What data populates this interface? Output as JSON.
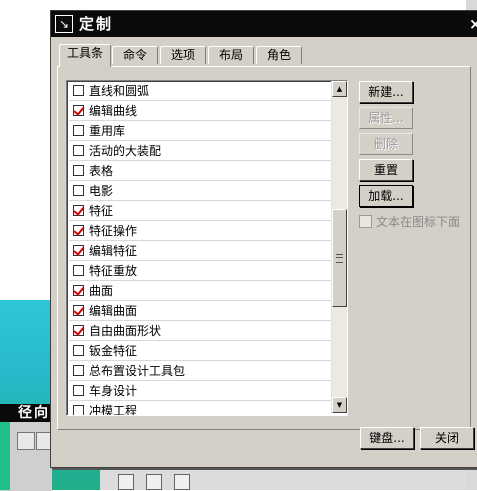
{
  "dialog": {
    "title": "定制",
    "close_glyph": "×",
    "icon_glyph": "↘"
  },
  "tabs": [
    {
      "label": "工具条",
      "active": true
    },
    {
      "label": "命令",
      "active": false
    },
    {
      "label": "选项",
      "active": false
    },
    {
      "label": "布局",
      "active": false
    },
    {
      "label": "角色",
      "active": false
    }
  ],
  "toolbar_list": [
    {
      "label": "直线和圆弧",
      "checked": false
    },
    {
      "label": "编辑曲线",
      "checked": true
    },
    {
      "label": "重用库",
      "checked": false
    },
    {
      "label": "活动的大装配",
      "checked": false
    },
    {
      "label": "表格",
      "checked": false
    },
    {
      "label": "电影",
      "checked": false
    },
    {
      "label": "特征",
      "checked": true
    },
    {
      "label": "特征操作",
      "checked": true
    },
    {
      "label": "编辑特征",
      "checked": true
    },
    {
      "label": "特征重放",
      "checked": false
    },
    {
      "label": "曲面",
      "checked": true
    },
    {
      "label": "编辑曲面",
      "checked": true
    },
    {
      "label": "自由曲面形状",
      "checked": true
    },
    {
      "label": "钣金特征",
      "checked": false
    },
    {
      "label": "总布置设计工具包",
      "checked": false
    },
    {
      "label": "车身设计",
      "checked": false
    },
    {
      "label": "冲模工程",
      "checked": false
    }
  ],
  "side_buttons": {
    "new_label": "新建...",
    "properties_label": "属性...",
    "delete_label": "删除",
    "reset_label": "重置",
    "load_label": "加载..."
  },
  "text_below_icon": {
    "label": "文本在图标下面",
    "checked": false
  },
  "bottom_buttons": {
    "keyboard_label": "键盘...",
    "close_label": "关闭"
  },
  "background": {
    "panel_title": "径向"
  },
  "colors": {
    "check_mark": "#d40000",
    "titlebar": "#0b0b0b",
    "dialog_face": "#d4d0c8"
  }
}
